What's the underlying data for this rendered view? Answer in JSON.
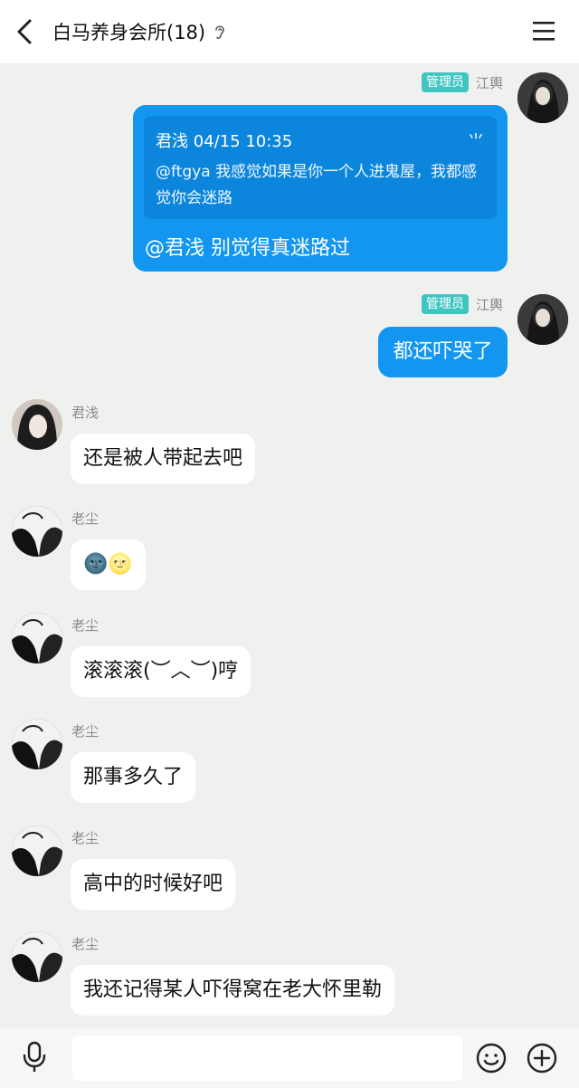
{
  "header": {
    "title": "白马养身会所(18)",
    "back_icon": "chevron-left-icon",
    "mode_icon": "ear-icon",
    "menu_icon": "hamburger-menu-icon"
  },
  "messages": [
    {
      "side": "out",
      "badge": "管理员",
      "sender": "江輿",
      "quote": {
        "header": "君浅 04/15 10:35",
        "close": "⺌",
        "text": "@ftgya 我感觉如果是你一个人进鬼屋，我都感觉你会迷路"
      },
      "text": "@君浅 别觉得真迷路过"
    },
    {
      "side": "out",
      "badge": "管理员",
      "sender": "江輿",
      "text": "都还吓哭了"
    },
    {
      "side": "in",
      "sender": "君浅",
      "text": "还是被人带起去吧"
    },
    {
      "side": "in",
      "sender": "老尘",
      "text": "🌚🌝"
    },
    {
      "side": "in",
      "sender": "老尘",
      "text": "滚滚滚(︶︿︶)哼"
    },
    {
      "side": "in",
      "sender": "老尘",
      "text": "那事多久了"
    },
    {
      "side": "in",
      "sender": "老尘",
      "text": "高中的时候好吧"
    },
    {
      "side": "in",
      "sender": "老尘",
      "text": "我还记得某人吓得窝在老大怀里勒"
    }
  ],
  "footer": {
    "input_value": "",
    "icons": [
      "microphone-icon",
      "emoji-icon",
      "plus-icon"
    ]
  },
  "colors": {
    "background": "#eef1ee",
    "outgoing_bubble": "#1296f0",
    "quote_bg": "#0c86dd",
    "admin_badge": "#3fc6c1"
  }
}
